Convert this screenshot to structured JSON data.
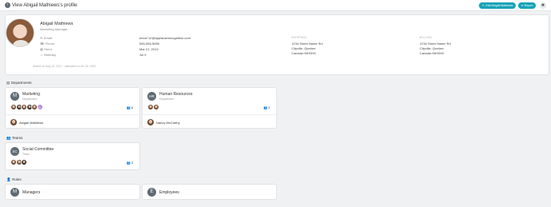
{
  "header": {
    "title": "View Abigail Mathiews's profile",
    "edit_label": "Edit Abigail Mathiews",
    "report_label": "Report"
  },
  "profile": {
    "name": "Abigail Mathiews",
    "job_title": "Marketing Manager",
    "fields": [
      {
        "label": "Email",
        "value": "erica+12@applauserecognition.com",
        "icon": "envelope-icon"
      },
      {
        "label": "Phone",
        "value": "555-555-5555",
        "icon": "phone-icon"
      },
      {
        "label": "Hired",
        "value": "Mar 21, 2019",
        "icon": "calendar-icon"
      },
      {
        "label": "Birthday",
        "value": "Jul 9",
        "icon": "cake-icon"
      }
    ],
    "shipping": {
      "heading": "SHIPPING",
      "lines": [
        "1234 Street Name Rd",
        "Cityville, Quebec",
        "Canada H0H0H0"
      ]
    },
    "billing": {
      "heading": "BILLING",
      "lines": [
        "1234 Street Name Rd",
        "Cityville, Quebec",
        "Canada H0H0H0"
      ]
    },
    "added_note": "Added on Aug 20, 2017 - activated on Jul 18, 2020"
  },
  "sections": {
    "departments": "Departments",
    "teams": "Teams",
    "roles": "Roles"
  },
  "departments": [
    {
      "initial": "M",
      "name": "Marketing",
      "type": "Department",
      "count": "6",
      "member": "Abigail Mathiews",
      "extra_initial": "D"
    },
    {
      "initial": "HR",
      "name": "Human Resources",
      "type": "Department",
      "count": "2",
      "member": "Nancy McCarthy"
    }
  ],
  "teams": [
    {
      "initial": "SC",
      "name": "Social Committee",
      "type": "Team",
      "count": "3"
    }
  ],
  "roles": [
    {
      "initial": "M",
      "name": "Managers"
    },
    {
      "initial": "E",
      "name": "Employees"
    }
  ],
  "colors": {
    "accent": "#17a2b8",
    "circle": "#5f6b73"
  }
}
